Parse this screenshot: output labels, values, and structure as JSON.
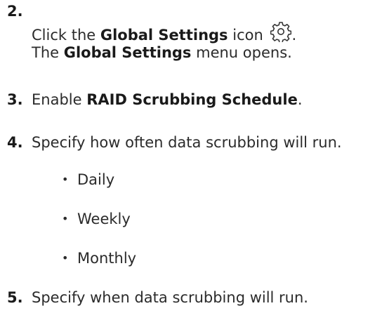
{
  "steps": [
    {
      "number": "2.",
      "line1": {
        "pre": "Click the ",
        "bold": "Global Settings",
        "post": " icon",
        "icon": "gear-icon",
        "end": "."
      },
      "line2": {
        "pre": "The ",
        "bold": "Global Settings",
        "post": " menu opens."
      }
    },
    {
      "number": "3.",
      "pre": "Enable ",
      "bold": "RAID Scrubbing Schedule",
      "post": "."
    },
    {
      "number": "4.",
      "text": "Specify how often data scrubbing will run.",
      "options": [
        "Daily",
        "Weekly",
        "Monthly"
      ]
    },
    {
      "number": "5.",
      "text": "Specify when data scrubbing will run."
    }
  ]
}
